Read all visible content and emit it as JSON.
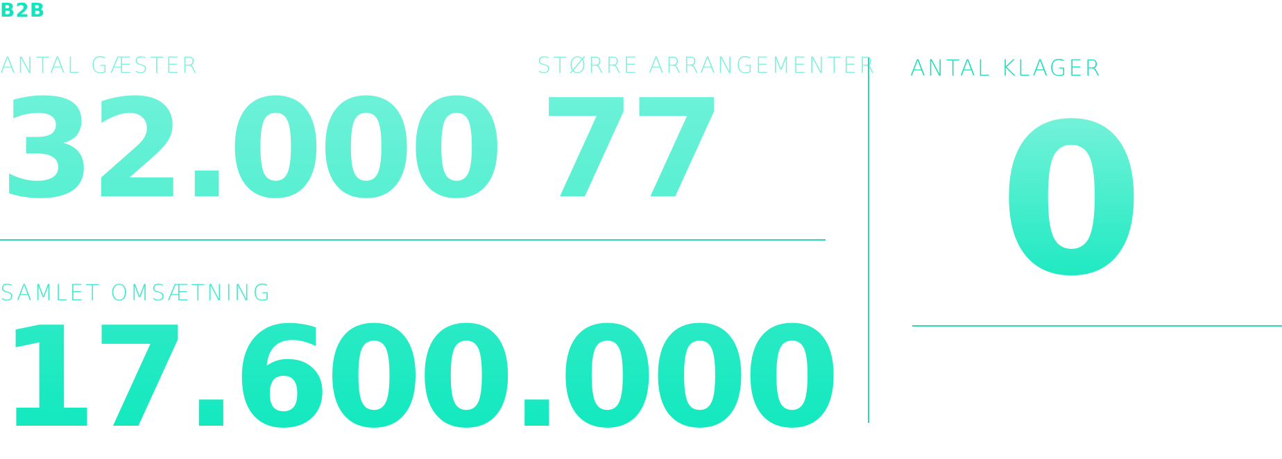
{
  "header": {
    "tag": "B2B"
  },
  "stats": {
    "guests": {
      "label": "ANTAL GÆSTER",
      "value": "32.000"
    },
    "events": {
      "label": "STØRRE ARRANGEMENTER",
      "value": "77"
    },
    "revenue": {
      "label": "SAMLET OMSÆTNING",
      "value": "17.600.000"
    },
    "complaints": {
      "label": "ANTAL KLAGER",
      "value": "0"
    }
  },
  "colors": {
    "accent": "#13e4bd",
    "accent_light": "#7ef0da",
    "rule": "#2cd6b7"
  }
}
